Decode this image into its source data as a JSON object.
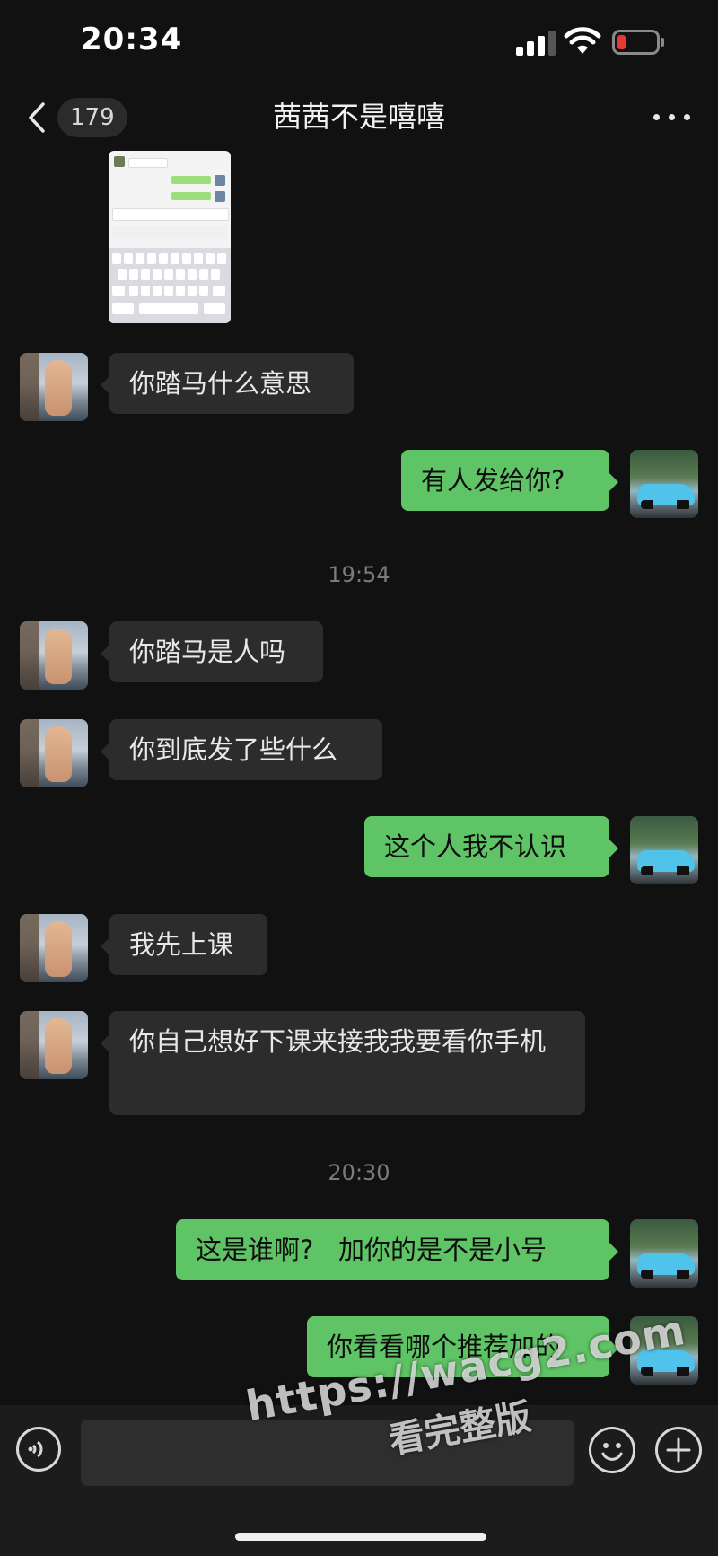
{
  "status_bar": {
    "time": "20:34",
    "icons": [
      "cellular-signal-icon",
      "wifi-icon",
      "battery-low-icon"
    ],
    "battery_color": "#e53935"
  },
  "nav": {
    "back_icon": "chevron-left-icon",
    "unread_count": "179",
    "title": "茜茜不是嘻嘻",
    "more_icon": "ellipsis-icon"
  },
  "messages": [
    {
      "side": "left",
      "type": "image",
      "description": "screenshot"
    },
    {
      "side": "left",
      "text": "你踏马什么意思"
    },
    {
      "side": "right",
      "text": "有人发给你?"
    },
    {
      "type": "timestamp",
      "text": "19:54"
    },
    {
      "side": "left",
      "text": "你踏马是人吗"
    },
    {
      "side": "left",
      "text": "你到底发了些什么"
    },
    {
      "side": "right",
      "text": "这个人我不认识"
    },
    {
      "side": "left",
      "text": "我先上课"
    },
    {
      "side": "left",
      "text": "你自己想好下课来接我我要看你手机"
    },
    {
      "type": "timestamp",
      "text": "20:30"
    },
    {
      "side": "right",
      "text": "这是谁啊?   加你的是不是小号"
    },
    {
      "side": "right",
      "text": "你看看哪个推荐加的"
    }
  ],
  "input_bar": {
    "voice_icon": "voice-icon",
    "input_value": "",
    "emoji_icon": "emoji-icon",
    "plus_icon": "plus-icon"
  },
  "watermark": {
    "url": "https://wacg2.com",
    "text": "看完整版"
  },
  "colors": {
    "background": "#111111",
    "incoming_bubble": "#2c2c2c",
    "outgoing_bubble": "#5fc465"
  }
}
